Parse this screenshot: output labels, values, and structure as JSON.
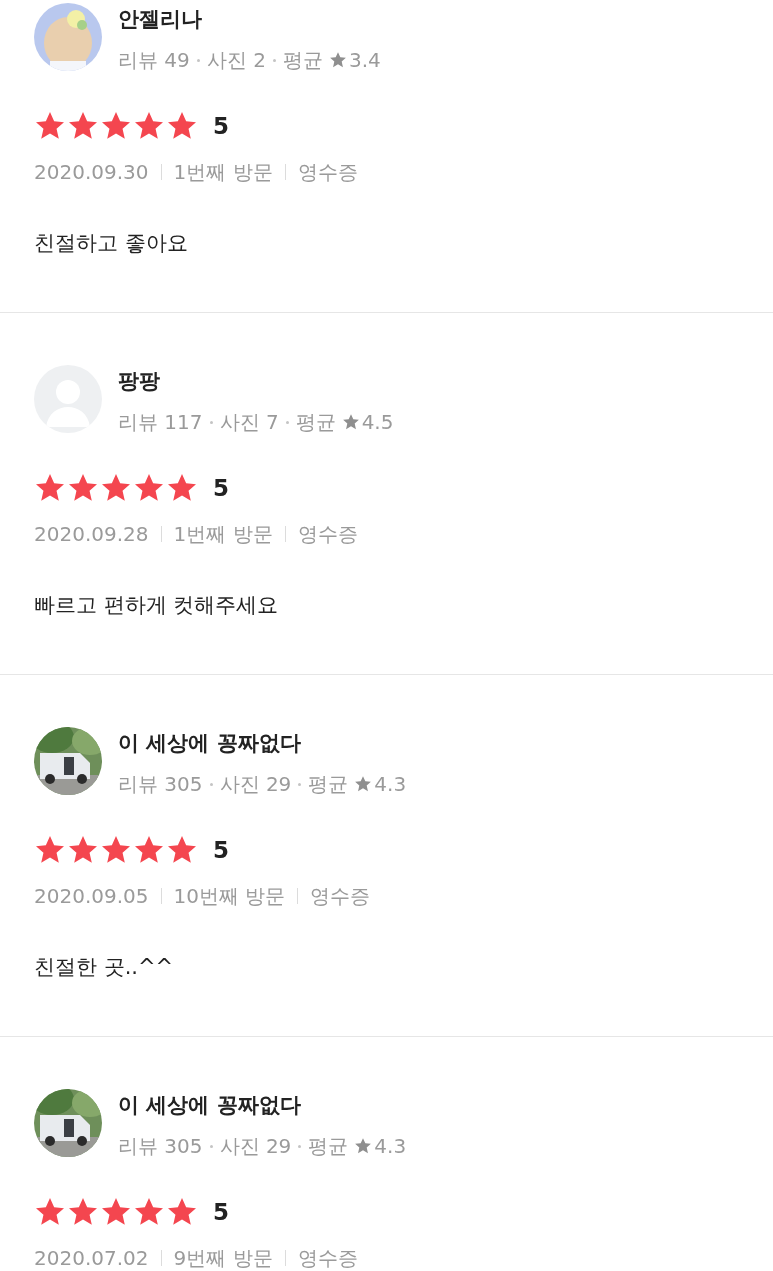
{
  "reviews": [
    {
      "avatar": {
        "kind": "illustration"
      },
      "name": "안젤리나",
      "reviews": "리뷰 49",
      "photos": "사진 2",
      "average_label": "평균",
      "average": "3.4",
      "stars": 5,
      "score": "5",
      "date": "2020.09.30",
      "visit": "1번째 방문",
      "receipt": "영수증",
      "text": "친절하고 좋아요"
    },
    {
      "avatar": {
        "kind": "default"
      },
      "name": "팡팡",
      "reviews": "리뷰 117",
      "photos": "사진 7",
      "average_label": "평균",
      "average": "4.5",
      "stars": 5,
      "score": "5",
      "date": "2020.09.28",
      "visit": "1번째 방문",
      "receipt": "영수증",
      "text": "빠르고 편하게 컷해주세요"
    },
    {
      "name": "이 세상에 꽁짜없다",
      "reviews": "리뷰 305",
      "photos": "사진 29",
      "average_label": "평균",
      "average": "4.3",
      "stars": 5,
      "score": "5",
      "date": "2020.09.05",
      "visit": "10번째 방문",
      "receipt": "영수증",
      "text": "친절한 곳..^^"
    },
    {
      "name": "이 세상에 꽁짜없다",
      "reviews": "리뷰 305",
      "photos": "사진 29",
      "average_label": "평균",
      "average": "4.3",
      "stars": 5,
      "score": "5",
      "date": "2020.07.02",
      "visit": "9번째 방문",
      "receipt": "영수증"
    }
  ]
}
